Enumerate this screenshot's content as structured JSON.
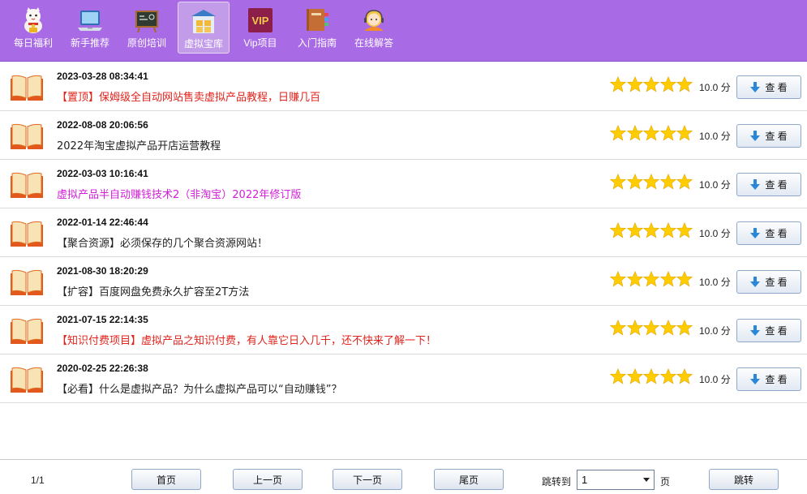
{
  "nav": {
    "items": [
      {
        "label": "每日福利",
        "icon": "lucky-cat-icon"
      },
      {
        "label": "新手推荐",
        "icon": "laptop-icon"
      },
      {
        "label": "原创培训",
        "icon": "blackboard-icon"
      },
      {
        "label": "虚拟宝库",
        "icon": "warehouse-icon",
        "active": true
      },
      {
        "label": "Vip项目",
        "icon": "vip-icon",
        "badge": "VIP"
      },
      {
        "label": "入门指南",
        "icon": "books-icon"
      },
      {
        "label": "在线解答",
        "icon": "support-agent-icon"
      }
    ]
  },
  "list": {
    "items": [
      {
        "date": "2023-03-28 08:34:41",
        "title": "【置顶】保姆级全自动网站售卖虚拟产品教程，日赚几百",
        "color": "red",
        "rating": 5,
        "score": "10.0 分"
      },
      {
        "date": "2022-08-08 20:06:56",
        "title": "2022年淘宝虚拟产品开店运营教程",
        "color": "normal",
        "rating": 5,
        "score": "10.0 分"
      },
      {
        "date": "2022-03-03 10:16:41",
        "title": "虚拟产品半自动赚钱技术2（非淘宝）2022年修订版",
        "color": "magenta",
        "rating": 5,
        "score": "10.0 分"
      },
      {
        "date": "2022-01-14 22:46:44",
        "title": "【聚合资源】必须保存的几个聚合资源网站！",
        "color": "normal",
        "rating": 5,
        "score": "10.0 分"
      },
      {
        "date": "2021-08-30 18:20:29",
        "title": "【扩容】百度网盘免费永久扩容至2T方法",
        "color": "normal",
        "rating": 5,
        "score": "10.0 分"
      },
      {
        "date": "2021-07-15 22:14:35",
        "title": "【知识付费项目】虚拟产品之知识付费，有人靠它日入几千，还不快来了解一下！",
        "color": "red",
        "rating": 5,
        "score": "10.0 分"
      },
      {
        "date": "2020-02-25 22:26:38",
        "title": "【必看】什么是虚拟产品？为什么虚拟产品可以“自动赚钱”？",
        "color": "normal",
        "rating": 5,
        "score": "10.0 分"
      }
    ],
    "view_label": "查 看"
  },
  "footer": {
    "page_info": "1/1",
    "first": "首页",
    "prev": "上一页",
    "next": "下一页",
    "last": "尾页",
    "jump_label": "跳转到",
    "jump_value": "1",
    "page_unit": "页",
    "jump_button": "跳转"
  },
  "colors": {
    "topbar": "#a96ae6",
    "red_title": "#e0231c",
    "magenta_title": "#d01fd6",
    "star": "#ffcc00"
  }
}
